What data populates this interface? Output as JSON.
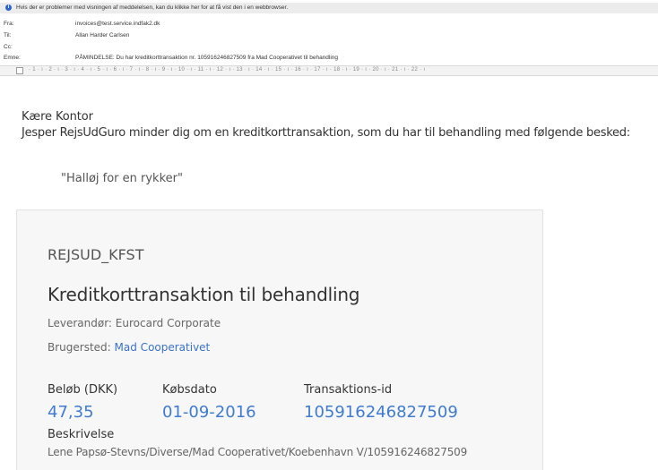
{
  "header": {
    "info_bar": "Hvis der er problemer med visningen af meddelelsen, kan du klikke her for at få vist den i en webbrowser.",
    "fields": [
      {
        "label": "Fra:",
        "value": "invoices@test.service.indfak2.dk"
      },
      {
        "label": "Til:",
        "value": "Allan Harder Carlsen"
      },
      {
        "label": "Cc:",
        "value": ""
      },
      {
        "label": "Emne:",
        "value": "PÅMINDELSE: Du har kreditkorttransaktion nr. 105916246827509 fra Mad Cooperativet til behandling"
      }
    ],
    "ruler_scale": "· 1 · ı · 2 · ı · 3 · ı · 4 · ı · 5 · ı · 6 · ı · 7 · ı · 8 · ı · 9 · ı · 10 · ı · 11 · ı · 12 · ı · 13 · ı · 14 · ı · 15 · ı · 16 · ı · 17 · ı · 18 · ı · 19 · ı · 20 · ı · 21 · ı · 22 · ı"
  },
  "body": {
    "greeting": "Kære Kontor",
    "intro": "Jesper RejsUdGuro minder dig om en kreditkorttransaktion, som du har til behandling med følgende besked:",
    "quote": "\"Halløj for en rykker\""
  },
  "card": {
    "code": "REJSUD_KFST",
    "title": "Kreditkorttransaktion til behandling",
    "leverandor_label": "Leverandør:",
    "leverandor_value": "Eurocard Corporate",
    "brugersted_label": "Brugersted:",
    "brugersted_value": "Mad Cooperativet",
    "columns": [
      {
        "label": "Beløb (DKK)",
        "value": "47,35"
      },
      {
        "label": "Købsdato",
        "value": "01-09-2016"
      },
      {
        "label": "Transaktions-id",
        "value": "105916246827509"
      }
    ],
    "beskrivelse_label": "Beskrivelse",
    "beskrivelse_value": "Lene Papsø-Stevns/Diverse/Mad Cooperativet/Koebenhavn V/105916246827509"
  },
  "colors": {
    "link": "#3a72c9",
    "value_blue": "#3f7bd0",
    "card_bg": "#f7f7f7",
    "info_icon": "#2b66c6"
  }
}
